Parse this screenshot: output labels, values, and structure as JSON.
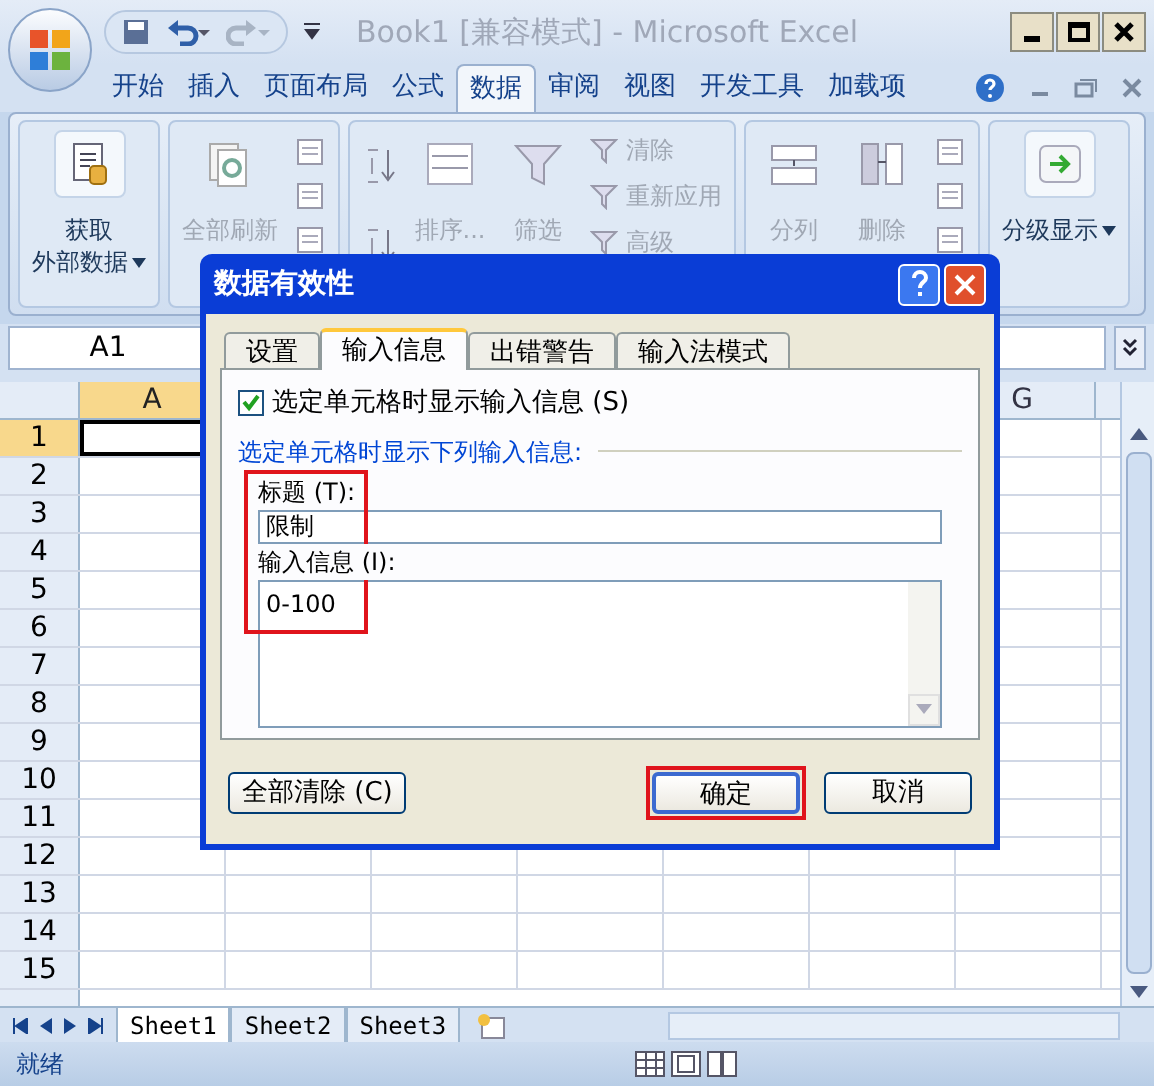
{
  "window": {
    "title": "Book1  [兼容模式] - Microsoft Excel"
  },
  "ribbon_tabs": [
    {
      "label": "开始",
      "selected": false
    },
    {
      "label": "插入",
      "selected": false
    },
    {
      "label": "页面布局",
      "selected": false
    },
    {
      "label": "公式",
      "selected": false
    },
    {
      "label": "数据",
      "selected": true
    },
    {
      "label": "审阅",
      "selected": false
    },
    {
      "label": "视图",
      "selected": false
    },
    {
      "label": "开发工具",
      "selected": false
    },
    {
      "label": "加载项",
      "selected": false
    }
  ],
  "ribbon_groups": [
    {
      "items": [
        {
          "kind": "large",
          "lines": [
            "获取",
            "外部数据"
          ],
          "disabled": false,
          "dropdown": true
        }
      ]
    },
    {
      "items": [
        {
          "kind": "large",
          "lines": [
            "全部刷新"
          ],
          "disabled": true,
          "dropdown": false
        },
        {
          "kind": "icon_stack"
        }
      ]
    },
    {
      "items": [
        {
          "kind": "sort_icons"
        },
        {
          "kind": "large",
          "lines": [
            "排序..."
          ],
          "disabled": true,
          "dropdown": false
        },
        {
          "kind": "large",
          "lines": [
            "筛选"
          ],
          "disabled": true,
          "dropdown": false
        },
        {
          "kind": "small_stack",
          "entries": [
            {
              "label": "清除",
              "disabled": true
            },
            {
              "label": "重新应用",
              "disabled": true
            },
            {
              "label": "高级",
              "disabled": true
            }
          ]
        }
      ]
    },
    {
      "items": [
        {
          "kind": "large",
          "lines": [
            "分列"
          ],
          "disabled": true,
          "dropdown": false
        },
        {
          "kind": "large",
          "lines": [
            "删除"
          ],
          "disabled": true,
          "dropdown": false
        },
        {
          "kind": "icon_stack"
        }
      ]
    },
    {
      "items": [
        {
          "kind": "large",
          "lines": [
            "分级显示"
          ],
          "disabled": false,
          "dropdown": true
        }
      ]
    }
  ],
  "name_box": "A1",
  "columns": [
    {
      "label": "A",
      "selected": true
    },
    {
      "label": "G",
      "selected": false
    }
  ],
  "rows": [
    {
      "label": "1",
      "selected": true
    },
    {
      "label": "2",
      "selected": false
    },
    {
      "label": "3",
      "selected": false
    },
    {
      "label": "4",
      "selected": false
    },
    {
      "label": "5",
      "selected": false
    },
    {
      "label": "6",
      "selected": false
    },
    {
      "label": "7",
      "selected": false
    },
    {
      "label": "8",
      "selected": false
    },
    {
      "label": "9",
      "selected": false
    },
    {
      "label": "10",
      "selected": false
    },
    {
      "label": "11",
      "selected": false
    },
    {
      "label": "12",
      "selected": false
    },
    {
      "label": "13",
      "selected": false
    },
    {
      "label": "14",
      "selected": false
    },
    {
      "label": "15",
      "selected": false
    }
  ],
  "sheet_tabs": [
    {
      "label": "Sheet1",
      "selected": true
    },
    {
      "label": "Sheet2",
      "selected": false
    },
    {
      "label": "Sheet3",
      "selected": false
    }
  ],
  "status_bar": {
    "text": "就绪"
  },
  "dialog": {
    "title": "数据有效性",
    "tabs": [
      {
        "label": "设置",
        "selected": false
      },
      {
        "label": "输入信息",
        "selected": true
      },
      {
        "label": "出错警告",
        "selected": false
      },
      {
        "label": "输入法模式",
        "selected": false
      }
    ],
    "checkbox": {
      "label": "选定单元格时显示输入信息 (S)",
      "checked": true
    },
    "section_label": "选定单元格时显示下列输入信息:",
    "title_field": {
      "label": "标题 (T):",
      "value": "限制"
    },
    "message_field": {
      "label": "输入信息 (I):",
      "value": "0-100"
    },
    "fields_highlighted": true,
    "buttons": [
      {
        "label": "全部清除 (C)",
        "highlighted": false,
        "default": false
      },
      {
        "label": "确定",
        "highlighted": true,
        "default": true
      },
      {
        "label": "取消",
        "highlighted": false,
        "default": false
      }
    ]
  }
}
